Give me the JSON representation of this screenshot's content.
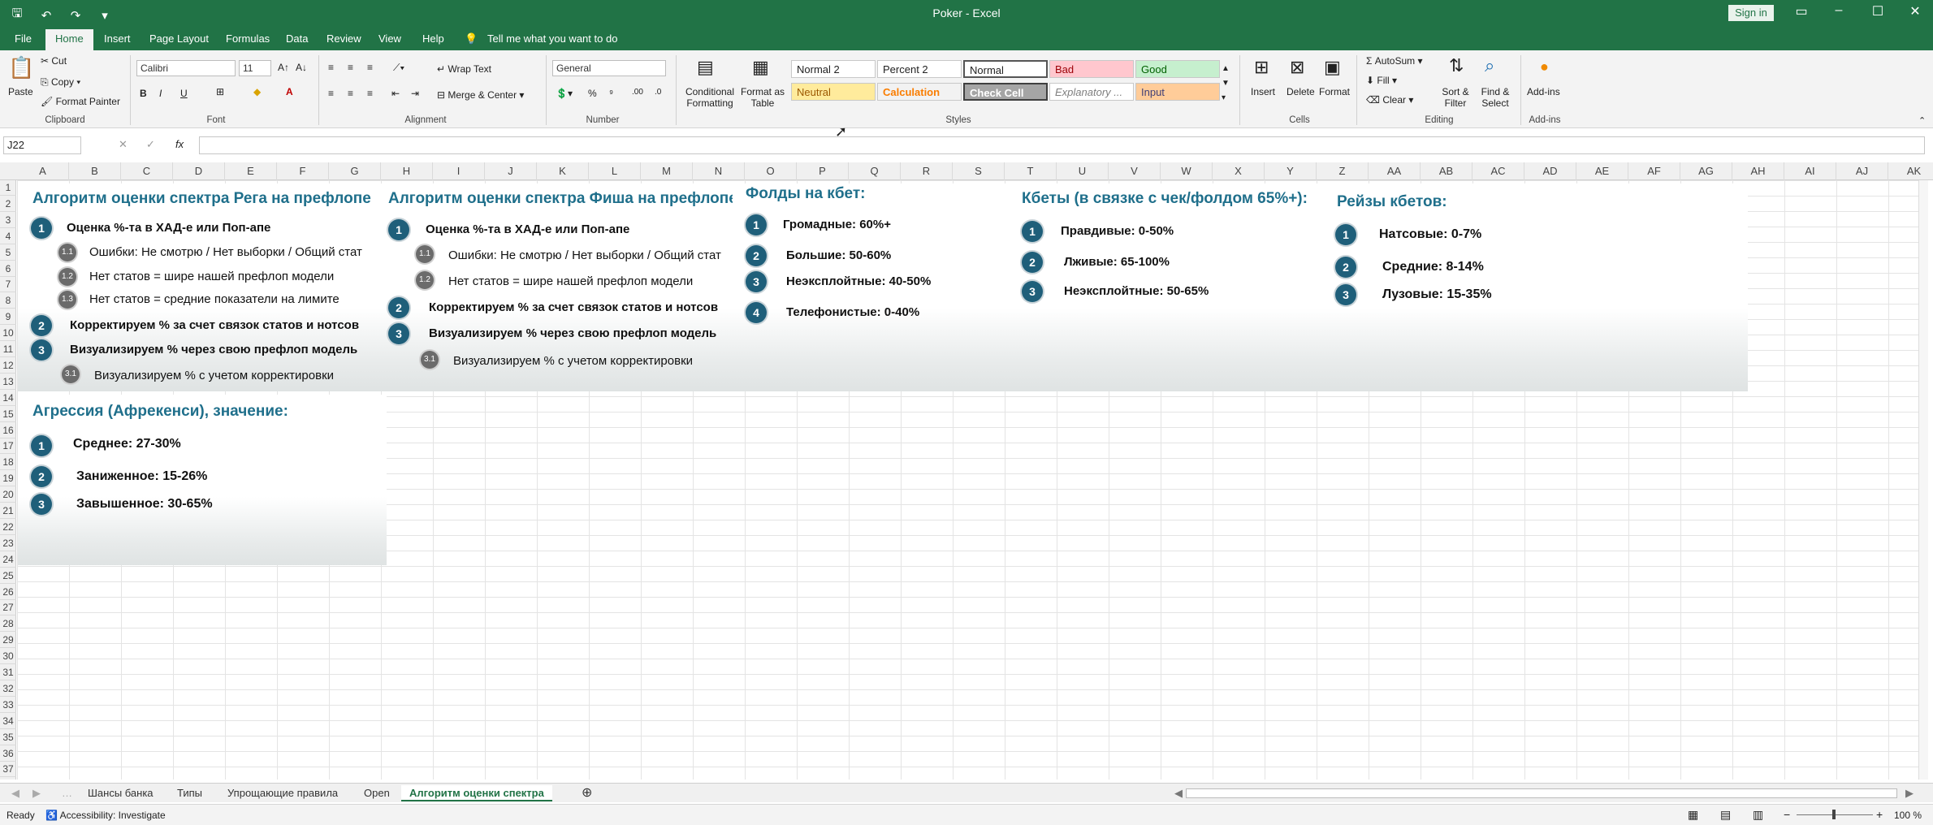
{
  "window": {
    "title": "Poker - Excel",
    "signin": "Sign in"
  },
  "tabs": [
    "File",
    "Home",
    "Insert",
    "Page Layout",
    "Formulas",
    "Data",
    "Review",
    "View",
    "Help"
  ],
  "tell_me": "Tell me what you want to do",
  "ribbon": {
    "clipboard": {
      "paste": "Paste",
      "cut": "Cut",
      "copy": "Copy",
      "format_painter": "Format Painter",
      "label": "Clipboard"
    },
    "font": {
      "name": "Calibri",
      "size": "11",
      "label": "Font"
    },
    "alignment": {
      "wrap": "Wrap Text",
      "merge": "Merge & Center",
      "label": "Alignment"
    },
    "number": {
      "format": "General",
      "label": "Number"
    },
    "styles": {
      "conditional": "Conditional Formatting",
      "format_table": "Format as Table",
      "label": "Styles",
      "cells": [
        {
          "name": "Normal 2",
          "bg": "#ffffff",
          "fg": "#222222"
        },
        {
          "name": "Percent 2",
          "bg": "#ffffff",
          "fg": "#222222"
        },
        {
          "name": "Normal",
          "bg": "#ffffff",
          "fg": "#222222"
        },
        {
          "name": "Bad",
          "bg": "#ffc7ce",
          "fg": "#9c0006"
        },
        {
          "name": "Good",
          "bg": "#c6efce",
          "fg": "#006100"
        },
        {
          "name": "Neutral",
          "bg": "#ffeb9c",
          "fg": "#9c5700"
        },
        {
          "name": "Calculation",
          "bg": "#f2f2f2",
          "fg": "#fa7d00"
        },
        {
          "name": "Check Cell",
          "bg": "#a5a5a5",
          "fg": "#ffffff"
        },
        {
          "name": "Explanatory ...",
          "bg": "#ffffff",
          "fg": "#7f7f7f"
        },
        {
          "name": "Input",
          "bg": "#ffcc99",
          "fg": "#3f3f76"
        }
      ]
    },
    "cells_group": {
      "insert": "Insert",
      "delete": "Delete",
      "format": "Format",
      "label": "Cells"
    },
    "editing": {
      "autosum": "AutoSum",
      "fill": "Fill",
      "clear": "Clear",
      "sort": "Sort & Filter",
      "find": "Find & Select",
      "label": "Editing"
    },
    "addins": {
      "addins": "Add-ins",
      "label": "Add-ins"
    }
  },
  "formula_bar": {
    "name_box": "J22",
    "fx": "fx",
    "value": ""
  },
  "columns": [
    "A",
    "B",
    "C",
    "D",
    "E",
    "F",
    "G",
    "H",
    "I",
    "J",
    "K",
    "L",
    "M",
    "N",
    "O",
    "P",
    "Q",
    "R",
    "S",
    "T",
    "U",
    "V",
    "W",
    "X",
    "Y",
    "Z",
    "AA",
    "AB",
    "AC",
    "AD",
    "AE",
    "AF",
    "AG",
    "AH",
    "AI",
    "AJ",
    "AK"
  ],
  "rows": [
    "1",
    "2",
    "3",
    "4",
    "5",
    "6",
    "7",
    "8",
    "9",
    "10",
    "11",
    "12",
    "13",
    "14",
    "15",
    "16",
    "17",
    "18",
    "19",
    "20",
    "21",
    "22",
    "23",
    "24",
    "25",
    "26",
    "27",
    "28",
    "29",
    "30",
    "31",
    "32",
    "33",
    "34",
    "35",
    "36",
    "37"
  ],
  "panels": {
    "reg": {
      "title": "Алгоритм оценки спектра Рега на префлопе",
      "i1": "Оценка %-та в ХАД-е или Поп-апе",
      "s11": "Ошибки: Не смотрю / Нет выборки / Общий стат",
      "s12": "Нет статов = шире нашей префлоп модели",
      "s13": "Нет статов = средние показатели на лимите",
      "i2": "Корректируем % за счет связок статов и нотсов",
      "i3": "Визуализируем % через свою префлоп модель",
      "s31": "Визуализируем % с учетом корректировки"
    },
    "fish": {
      "title": "Алгоритм оценки спектра Фиша на префлопе",
      "i1": "Оценка %-та в ХАД-е или Поп-апе",
      "s11": "Ошибки: Не смотрю / Нет выборки / Общий стат",
      "s12": "Нет статов = шире нашей префлоп модели",
      "i2": "Корректируем % за счет связок статов и нотсов",
      "i3": "Визуализируем % через свою префлоп модель",
      "s31": "Визуализируем % с учетом корректировки"
    },
    "folds": {
      "title": "Фолды на кбет:",
      "i1": "Громадные: 60%+",
      "i2": "Большие: 50-60%",
      "i3": "Неэксплойтные: 40-50%",
      "i4": "Телефонистые: 0-40%"
    },
    "cbets": {
      "title": "Кбеты (в связке с чек/фолдом 65%+):",
      "i1": "Правдивые: 0-50%",
      "i2": "Лживые: 65-100%",
      "i3": "Неэксплойтные: 50-65%"
    },
    "raises": {
      "title": "Рейзы кбетов:",
      "i1": "Натсовые: 0-7%",
      "i2": "Средние: 8-14%",
      "i3": "Лузовые: 15-35%"
    },
    "aggr": {
      "title": "Агрессия (Афрекенси), значение:",
      "i1": "Среднее: 27-30%",
      "i2": "Заниженное: 15-26%",
      "i3": "Завышенное: 30-65%"
    }
  },
  "numbers": {
    "n1": "1",
    "n2": "2",
    "n3": "3",
    "n4": "4",
    "s11": "1.1",
    "s12": "1.2",
    "s13": "1.3",
    "s31": "3.1"
  },
  "sheets": [
    "Шансы банка",
    "Типы",
    "Упрощающие правила",
    "Open",
    "Алгоритм оценки спектра"
  ],
  "status": {
    "ready": "Ready",
    "accessibility": "Accessibility: Investigate",
    "zoom": "100 %"
  }
}
